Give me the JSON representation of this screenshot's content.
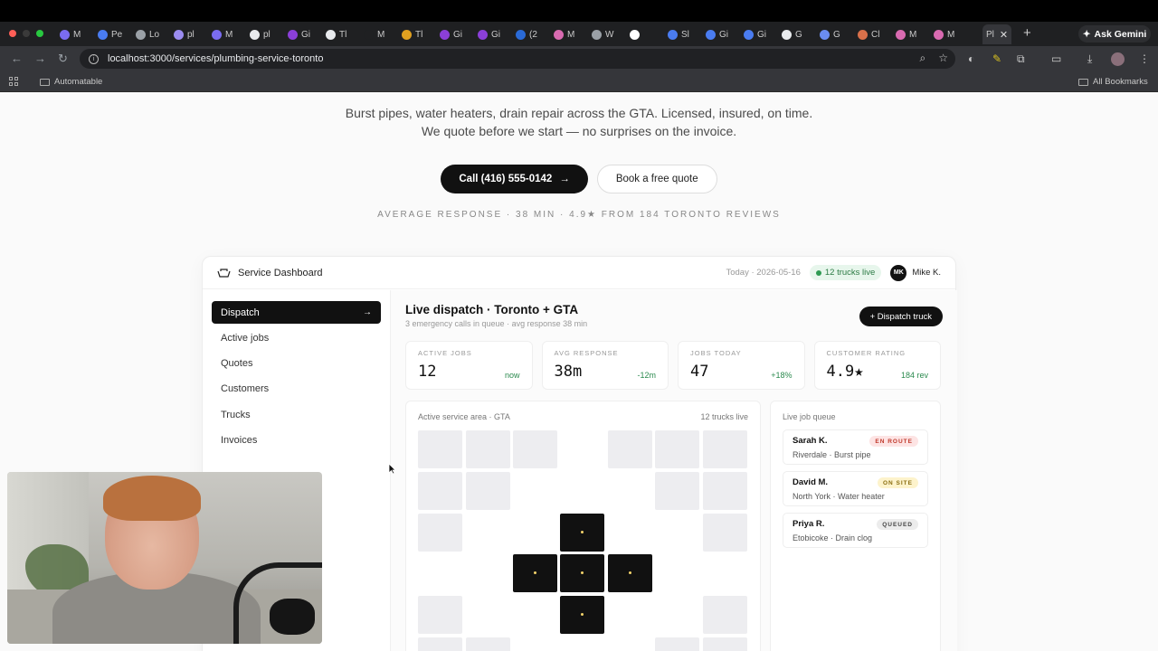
{
  "browser": {
    "tabs": [
      {
        "label": "M",
        "color": "#7a6cf0"
      },
      {
        "label": "Pe",
        "color": "#4a7cf0"
      },
      {
        "label": "Lo",
        "color": "#9aa0a6"
      },
      {
        "label": "pl",
        "color": "#9b8cf0"
      },
      {
        "label": "M",
        "color": "#7a6cf0"
      },
      {
        "label": "pl",
        "color": "#e8eaed"
      },
      {
        "label": "Gi",
        "color": "#8b3fd8"
      },
      {
        "label": "Tl",
        "color": "#e8eaed"
      },
      {
        "label": "M",
        "color": "#1f2022"
      },
      {
        "label": "Tl",
        "color": "#e0a020"
      },
      {
        "label": "Gi",
        "color": "#8b3fd8"
      },
      {
        "label": "Gi",
        "color": "#8b3fd8"
      },
      {
        "label": "(2",
        "color": "#2a6ad6"
      },
      {
        "label": "M",
        "color": "#d86ab0"
      },
      {
        "label": "W",
        "color": "#9aa0a6"
      },
      {
        "label": "",
        "color": "#fff"
      },
      {
        "label": "Sl",
        "color": "#4a7cf0"
      },
      {
        "label": "Gi",
        "color": "#4a7cf0"
      },
      {
        "label": "Gi",
        "color": "#4a7cf0"
      },
      {
        "label": "G",
        "color": "#e8eaed"
      },
      {
        "label": "G",
        "color": "#6a8cf0"
      },
      {
        "label": "Cl",
        "color": "#d8704a"
      },
      {
        "label": "M",
        "color": "#d86ab0"
      },
      {
        "label": "M",
        "color": "#d86ab0"
      }
    ],
    "active_tab_label": "Pl",
    "ask_gemini": "Ask Gemini",
    "url": "localhost:3000/services/plumbing-service-toronto",
    "bookmarks": {
      "automatable": "Automatable",
      "all_bookmarks": "All Bookmarks"
    }
  },
  "hero": {
    "lede_line1": "Burst pipes, water heaters, drain repair across the GTA. Licensed, insured, on time.",
    "lede_line2": "We quote before we start — no surprises on the invoice.",
    "call_button": "Call (416) 555-0142",
    "quote_button": "Book a free quote",
    "stats": "AVERAGE RESPONSE · 38 MIN · 4.9★ FROM 184 TORONTO REVIEWS"
  },
  "dashboard": {
    "title": "Service Dashboard",
    "date": "Today · 2026-05-16",
    "trucks_live_pill": "12 trucks live",
    "user_initials": "MK",
    "user_name": "Mike K.",
    "nav": [
      "Dispatch",
      "Active jobs",
      "Quotes",
      "Customers",
      "Trucks",
      "Invoices"
    ],
    "heading": "Live dispatch · Toronto + GTA",
    "subheading": "3 emergency calls in queue · avg response 38 min",
    "dispatch_button": "+ Dispatch truck",
    "kpis": [
      {
        "label": "ACTIVE JOBS",
        "value": "12",
        "delta": "now"
      },
      {
        "label": "AVG RESPONSE",
        "value": "38m",
        "delta": "-12m"
      },
      {
        "label": "JOBS TODAY",
        "value": "47",
        "delta": "+18%"
      },
      {
        "label": "CUSTOMER RATING",
        "value": "4.9★",
        "delta": "184 rev"
      }
    ],
    "map": {
      "title": "Active service area · GTA",
      "trucks": "12 trucks live"
    },
    "queue": {
      "title": "Live job queue",
      "jobs": [
        {
          "name": "Sarah K.",
          "desc": "Riverdale · Burst pipe",
          "status": "EN ROUTE",
          "status_bg": "#fde4e4",
          "status_fg": "#c0392b"
        },
        {
          "name": "David M.",
          "desc": "North York · Water heater",
          "status": "ON SITE",
          "status_bg": "#fdf3cc",
          "status_fg": "#8a6d10"
        },
        {
          "name": "Priya R.",
          "desc": "Etobicoke · Drain clog",
          "status": "QUEUED",
          "status_bg": "#ececec",
          "status_fg": "#444"
        }
      ]
    }
  }
}
